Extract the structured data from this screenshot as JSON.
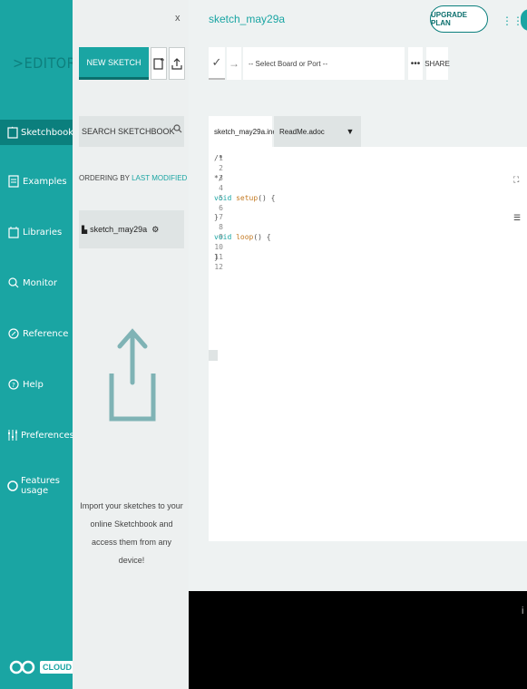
{
  "sidebar": {
    "logo_text": "EDITOR",
    "items": [
      {
        "label": "Sketchbook",
        "icon": "folder-icon"
      },
      {
        "label": "Examples",
        "icon": "book-icon"
      },
      {
        "label": "Libraries",
        "icon": "library-icon"
      },
      {
        "label": "Monitor",
        "icon": "monitor-icon"
      },
      {
        "label": "Reference",
        "icon": "compass-icon"
      },
      {
        "label": "Help",
        "icon": "help-icon"
      },
      {
        "label": "Preferences",
        "icon": "sliders-icon"
      },
      {
        "label": "Features usage",
        "icon": "usage-icon"
      }
    ],
    "cloud_badge": "CLOUD"
  },
  "sketchbook": {
    "close": "x",
    "new_sketch": "NEW SKETCH",
    "search_placeholder": "SEARCH SKETCHBOOK",
    "ordering_prefix": "ORDERING BY",
    "ordering_value": "LAST MODIFIED",
    "sketch_name": "sketch_may29a",
    "import_text": "Import your sketches to your online Sketchbook and access them from any device!"
  },
  "header": {
    "sketch_title": "sketch_may29a",
    "upgrade_label": "UPGRADE PLAN"
  },
  "toolbar": {
    "verify": "✓",
    "upload": "→",
    "board_placeholder": "-- Select Board or Port --",
    "more": "•••",
    "share": "SHARE"
  },
  "tabs": [
    {
      "label": "sketch_may29a.ino"
    },
    {
      "label": "ReadMe.adoc"
    }
  ],
  "code": {
    "line_numbers": [
      "1",
      "2",
      "3",
      "4",
      "5",
      "6",
      "7",
      "8",
      "9",
      "10",
      "11",
      "12"
    ],
    "lines": [
      {
        "prefix": "",
        "text": "/*"
      },
      {
        "prefix": "",
        "text": ""
      },
      {
        "prefix": "",
        "text": "*/"
      },
      {
        "prefix": "",
        "text": ""
      },
      {
        "kw": "void",
        "fn": "setup",
        "rest": "() {"
      },
      {
        "prefix": "",
        "text": ""
      },
      {
        "prefix": "",
        "text": "}"
      },
      {
        "prefix": "",
        "text": ""
      },
      {
        "kw": "void",
        "fn": "loop",
        "rest": "() {"
      },
      {
        "prefix": "",
        "text": ""
      },
      {
        "prefix": "",
        "text": "}"
      },
      {
        "prefix": "",
        "text": ""
      }
    ]
  },
  "colors": {
    "accent": "#1aa5a3",
    "accent_dark": "#0b7f7d",
    "console_bg": "#000000"
  }
}
